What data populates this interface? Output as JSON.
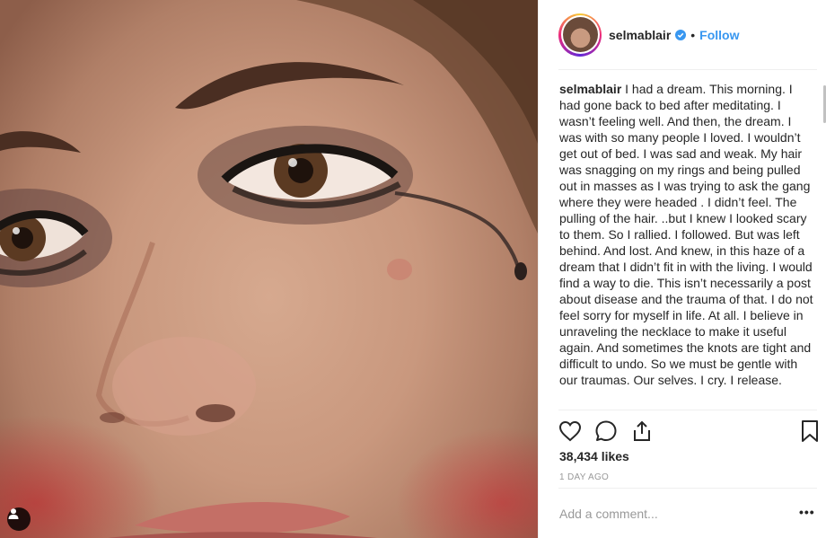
{
  "post": {
    "image_alt": "Close-up photo of a woman's face with smeared eye makeup",
    "user_tag_icon": "person-tag-icon"
  },
  "header": {
    "username": "selmablair",
    "verified_icon": "verified-badge-icon",
    "separator": "•",
    "follow_label": "Follow"
  },
  "caption": {
    "username": "selmablair",
    "text": "I had a dream. This morning. I had gone back to bed after meditating. I wasn’t feeling well. And then, the dream. I was with so many people I loved. I wouldn’t get out of bed. I was sad and weak. My hair was snagging on my rings and being pulled out in masses as I was trying to ask the gang where they were headed . I didn’t feel. The pulling of the hair. ..but I knew I looked scary to them. So I rallied. I followed. But was left behind. And lost. And knew, in this haze of a dream that I didn’t fit in with the living. I would find a way to die. This isn’t necessarily a post about disease and the trauma of that. I do not feel sorry for myself in life. At all. I believe in unraveling the necklace to make it useful again. And sometimes the knots are tight and difficult to undo. So we must be gentle with our traumas. Our selves. I cry. I release."
  },
  "actions": {
    "like_icon": "heart-icon",
    "comment_icon": "comment-bubble-icon",
    "share_icon": "share-icon",
    "save_icon": "bookmark-icon"
  },
  "stats": {
    "likes": "38,434 likes",
    "time_ago": "1 DAY AGO"
  },
  "comment_box": {
    "placeholder": "Add a comment...",
    "more_label": "•••"
  },
  "colors": {
    "link_blue": "#3897f0",
    "text": "#262626",
    "muted": "#999999",
    "divider": "#efefef"
  }
}
